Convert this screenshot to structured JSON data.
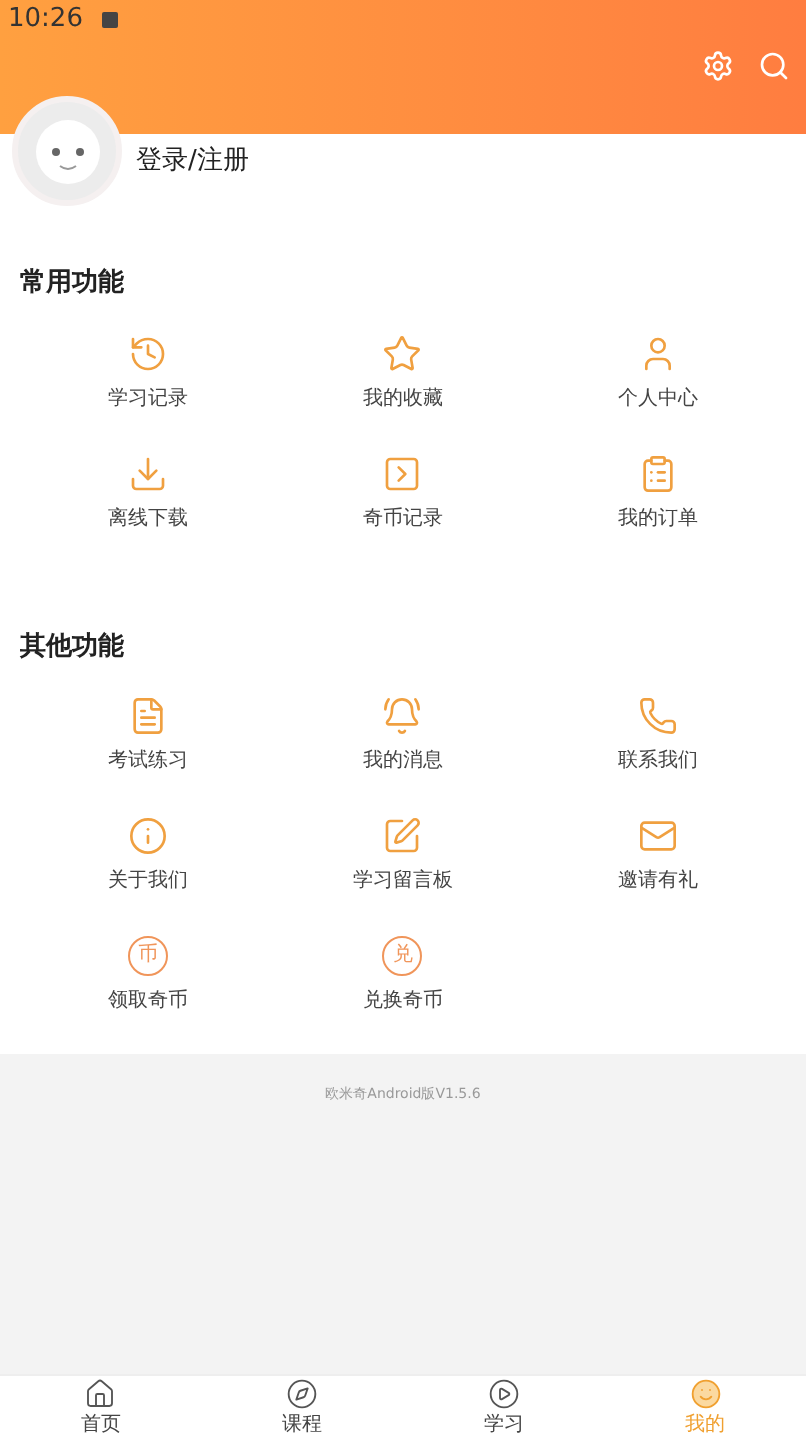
{
  "status_bar": {
    "time": "10:26"
  },
  "profile": {
    "login_label": "登录/注册"
  },
  "sections": [
    {
      "title": "常用功能",
      "items": [
        {
          "label": "学习记录"
        },
        {
          "label": "我的收藏"
        },
        {
          "label": "个人中心"
        },
        {
          "label": "离线下载"
        },
        {
          "label": "奇币记录"
        },
        {
          "label": "我的订单"
        }
      ]
    },
    {
      "title": "其他功能",
      "items": [
        {
          "label": "考试练习"
        },
        {
          "label": "我的消息"
        },
        {
          "label": "联系我们"
        },
        {
          "label": "关于我们"
        },
        {
          "label": "学习留言板"
        },
        {
          "label": "邀请有礼"
        },
        {
          "label": "领取奇币",
          "glyph": "币"
        },
        {
          "label": "兑换奇币",
          "glyph": "兑"
        }
      ]
    }
  ],
  "version": "欧米奇Android版V1.5.6",
  "tabs": [
    {
      "label": "首页",
      "selected": false
    },
    {
      "label": "课程",
      "selected": false
    },
    {
      "label": "学习",
      "selected": false
    },
    {
      "label": "我的",
      "selected": true
    }
  ]
}
